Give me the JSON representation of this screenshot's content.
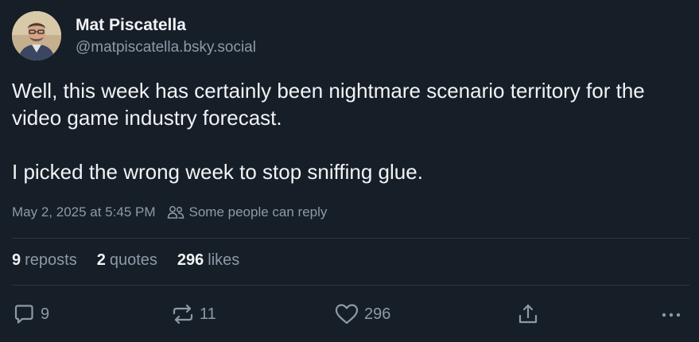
{
  "author": {
    "name": "Mat Piscatella",
    "handle": "@matpiscatella.bsky.social"
  },
  "post": {
    "paragraphs": [
      "Well, this week has certainly been nightmare scenario territory for the video game industry forecast.",
      "I picked the wrong week to stop sniffing glue."
    ],
    "timestamp": "May 2, 2025 at 5:45 PM",
    "reply_setting": "Some people can reply"
  },
  "stats": {
    "reposts_count": "9",
    "reposts_label": "reposts",
    "quotes_count": "2",
    "quotes_label": "quotes",
    "likes_count": "296",
    "likes_label": "likes"
  },
  "actions": {
    "reply_count": "9",
    "repost_count": "11",
    "like_count": "296"
  },
  "icons": {
    "reply": "speech-bubble-icon",
    "repost": "repost-arrows-icon",
    "like": "heart-icon",
    "share": "share-icon",
    "more": "ellipsis-icon",
    "reply_setting": "people-icon"
  },
  "colors": {
    "background": "#161e27",
    "text": "#f1f3f5",
    "muted": "#8c9aa8",
    "divider": "#2e3945"
  }
}
